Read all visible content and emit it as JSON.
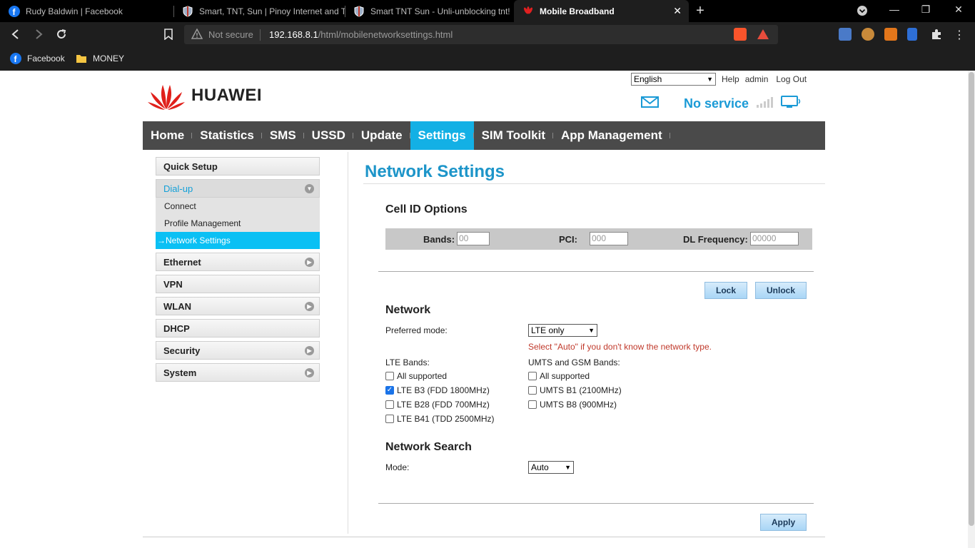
{
  "browser": {
    "tabs": [
      {
        "label": "Rudy Baldwin | Facebook",
        "icon": "facebook-icon"
      },
      {
        "label": "Smart, TNT, Sun | Pinoy Internet and T",
        "icon": "forum-shield-icon"
      },
      {
        "label": "Smart TNT Sun - Unli-unblocking tnt!",
        "icon": "forum-shield-icon"
      },
      {
        "label": "Mobile Broadband",
        "icon": "huawei-icon"
      }
    ],
    "address": {
      "security_label": "Not secure",
      "host": "192.168.8.1",
      "path": "/html/mobilenetworksettings.html"
    },
    "bookmarks": [
      {
        "label": "Facebook",
        "icon": "facebook-icon"
      },
      {
        "label": "MONEY",
        "icon": "folder-icon"
      }
    ]
  },
  "header": {
    "language": "English",
    "links": [
      "Help",
      "admin",
      "Log Out"
    ],
    "brand": "HUAWEI",
    "status": "No service",
    "colors": {
      "accent": "#1a9ad6",
      "nav_bg": "#4a4a4a",
      "nav_active": "#13b0e5"
    }
  },
  "nav": [
    "Home",
    "Statistics",
    "SMS",
    "USSD",
    "Update",
    "Settings",
    "SIM Toolkit",
    "App Management"
  ],
  "sidebar": {
    "quick_setup": "Quick Setup",
    "dialup": "Dial-up",
    "dialup_sub": [
      "Connect",
      "Profile Management",
      "Network Settings"
    ],
    "ethernet": "Ethernet",
    "vpn": "VPN",
    "wlan": "WLAN",
    "dhcp": "DHCP",
    "security": "Security",
    "system": "System"
  },
  "content": {
    "title": "Network Settings",
    "cell_id": {
      "heading": "Cell ID Options",
      "bands_label": "Bands:",
      "bands_value": "00",
      "pci_label": "PCI:",
      "pci_value": "000",
      "dl_label": "DL Frequency:",
      "dl_value": "00000"
    },
    "lock_label": "Lock",
    "unlock_label": "Unlock",
    "network": {
      "heading": "Network",
      "preferred_label": "Preferred mode:",
      "preferred_value": "LTE only",
      "hint": "Select \"Auto\" if you don't know the network type.",
      "lte_heading": "LTE Bands:",
      "lte_bands": [
        {
          "label": "All supported",
          "checked": false
        },
        {
          "label": "LTE B3 (FDD 1800MHz)",
          "checked": true
        },
        {
          "label": "LTE B28 (FDD 700MHz)",
          "checked": false
        },
        {
          "label": "LTE B41 (TDD 2500MHz)",
          "checked": false
        }
      ],
      "umts_heading": "UMTS and GSM Bands:",
      "umts_bands": [
        {
          "label": "All supported",
          "checked": false
        },
        {
          "label": "UMTS B1 (2100MHz)",
          "checked": false
        },
        {
          "label": "UMTS B8 (900MHz)",
          "checked": false
        }
      ]
    },
    "search": {
      "heading": "Network Search",
      "mode_label": "Mode:",
      "mode_value": "Auto"
    },
    "apply_label": "Apply"
  }
}
